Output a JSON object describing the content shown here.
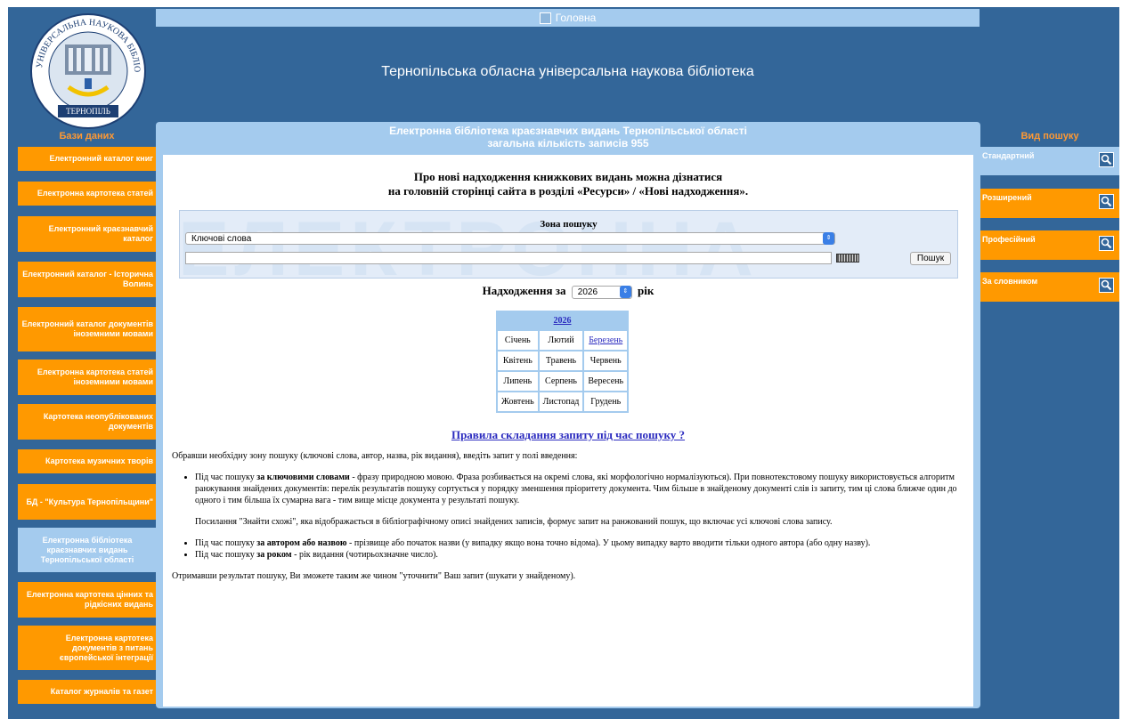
{
  "header": {
    "home_label": "Головна",
    "site_title": "Тернопільська обласна універсальна наукова бібліотека",
    "logo_text_top": "УНІВЕРСАЛЬНА НАУКОВА БІБЛІОТЕКА",
    "logo_text_bottom": "ТЕРНОПІЛЬ"
  },
  "left_sidebar": {
    "title": "Бази даних",
    "items": [
      {
        "label": "Електронний каталог книг"
      },
      {
        "label": "Електронна картотека статей"
      },
      {
        "label": "Електронний краєзнавчий каталог"
      },
      {
        "label": "Електронний каталог - Історична Волинь"
      },
      {
        "label": "Електронний каталог документів іноземними мовами"
      },
      {
        "label": "Електронна картотека статей іноземними мовами"
      },
      {
        "label": "Картотека неопублікованих документів"
      },
      {
        "label": "Картотека музичних творів"
      },
      {
        "label": "БД - \"Культура Тернопільщини\""
      },
      {
        "label": "Електронна бібліотека краєзнавчих видань Тернопільської області"
      },
      {
        "label": "Електронна картотека цінних та рідкісних видань"
      },
      {
        "label": "Електронна картотека документів з питань європейської інтеграції"
      },
      {
        "label": "Каталог журналів та газет"
      }
    ]
  },
  "right_sidebar": {
    "title": "Вид пошуку",
    "items": [
      {
        "label": "Стандартний"
      },
      {
        "label": "Розширений"
      },
      {
        "label": "Професійний"
      },
      {
        "label": "За словником"
      }
    ]
  },
  "main": {
    "heading_line1": "Електронна бібліотека краєзнавчих видань Тернопільської області",
    "heading_line2": "загальна кількість записів 955",
    "notice_line1": "Про нові надходження книжкових видань можна дізнатися",
    "notice_line2": "на головній сторінці сайта в розділі «Ресурси» / «Нові надходження».",
    "search": {
      "zone_label": "Зона пошуку",
      "zone_selected": "Ключові слова",
      "query_value": "",
      "button_label": "Пошук"
    },
    "arrivals": {
      "prefix": "Надходження за",
      "year": "2026",
      "suffix": "рік"
    },
    "calendar": {
      "year_link": "2026",
      "months": [
        "Січень",
        "Лютий",
        "Березень",
        "Квітень",
        "Травень",
        "Червень",
        "Липень",
        "Серпень",
        "Вересень",
        "Жовтень",
        "Листопад",
        "Грудень"
      ]
    },
    "rules_link": "Правила складання запиту під час пошуку ?",
    "help": {
      "intro": "Обравши необхідну зону пошуку (ключові слова, автор, назва, рік видання), введіть запит у полі введення:",
      "b1_pre": "Під час пошуку ",
      "b1_bold": "за ключовими словами",
      "b1_rest": " - фразу природною мовою. Фраза розбивається на окремі слова, які морфологічно нормалізуються). При повнотекстовому пошуку використовується алгоритм ранжування знайдених документів: перелік результатів пошуку сортується у порядку зменшення пріоритету документа. Чим більше в знайденому документі слів із запиту, тим ці слова ближче один до одного і тим більша їх сумарна вага - тим вище місце документа у результаті пошуку.",
      "b1_sub": "Посилання \"Знайти схожі\", яка відображається в бібліографічному описі знайдених записів, формує запит на ранжований пошук, що включає усі ключові слова запису.",
      "b2_pre": "Під час пошуку ",
      "b2_bold": "за автором або назвою",
      "b2_rest": " - прізвище або початок назви (у випадку якщо вона точно відома). У цьому випадку варто вводити тільки одного автора (або одну назву).",
      "b3_pre": "Під час пошуку ",
      "b3_bold": "за роком",
      "b3_rest": " - рік видання (чотирьохзначне число).",
      "outro": "Отримавши результат пошуку, Ви зможете таким же чином \"уточнити\" Ваш запит (шукати у знайденому)."
    }
  },
  "colors": {
    "frame": "#336699",
    "light_blue": "#a4cbee",
    "orange": "#ff9900",
    "link": "#2b2bbf"
  }
}
